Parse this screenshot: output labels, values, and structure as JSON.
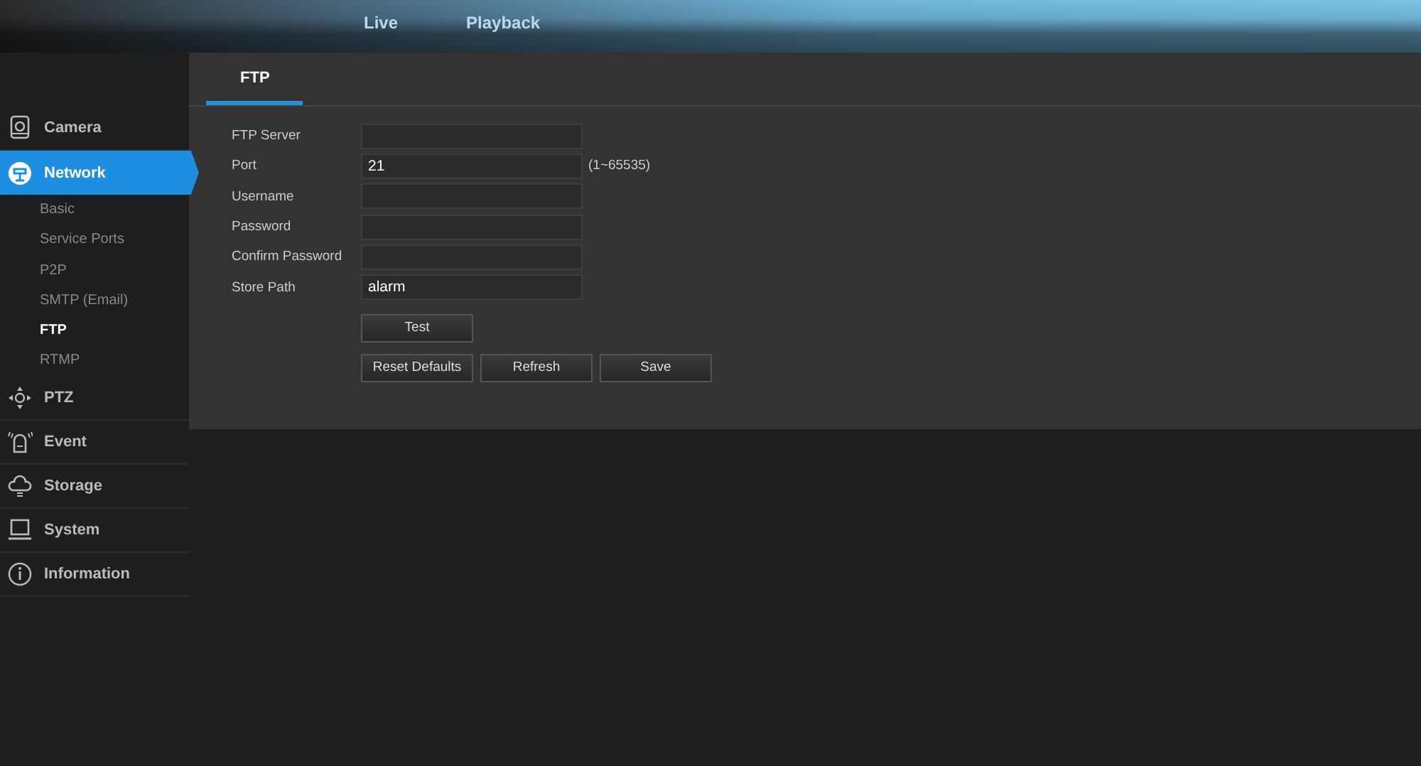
{
  "top_nav": [
    {
      "label": "Live",
      "selected": false
    },
    {
      "label": "Playback",
      "selected": false
    }
  ],
  "sidebar": {
    "items": [
      {
        "label": "Camera",
        "kind": "camera",
        "selected": false
      },
      {
        "label": "Network",
        "kind": "network",
        "selected": true,
        "children": [
          {
            "label": "Basic",
            "selected": false
          },
          {
            "label": "Service Ports",
            "selected": false
          },
          {
            "label": "P2P",
            "selected": false
          },
          {
            "label": "SMTP (Email)",
            "selected": false
          },
          {
            "label": "FTP",
            "selected": true
          },
          {
            "label": "RTMP",
            "selected": false
          }
        ]
      },
      {
        "label": "PTZ",
        "kind": "ptz",
        "selected": false
      },
      {
        "label": "Event",
        "kind": "event",
        "selected": false
      },
      {
        "label": "Storage",
        "kind": "storage",
        "selected": false
      },
      {
        "label": "System",
        "kind": "system",
        "selected": false
      },
      {
        "label": "Information",
        "kind": "info",
        "selected": false
      }
    ]
  },
  "tabs": [
    {
      "label": "FTP",
      "selected": true
    }
  ],
  "form": {
    "fields": [
      {
        "label": "FTP Server"
      },
      {
        "label": "Port",
        "value": "21",
        "hint": "(1~65535)"
      },
      {
        "label": "Username"
      },
      {
        "label": "Password"
      },
      {
        "label": "Confirm Password"
      },
      {
        "label": "Store Path",
        "value": "alarm"
      }
    ],
    "test_button": "Test",
    "buttons": [
      "Reset Defaults",
      "Refresh",
      "Save"
    ]
  }
}
